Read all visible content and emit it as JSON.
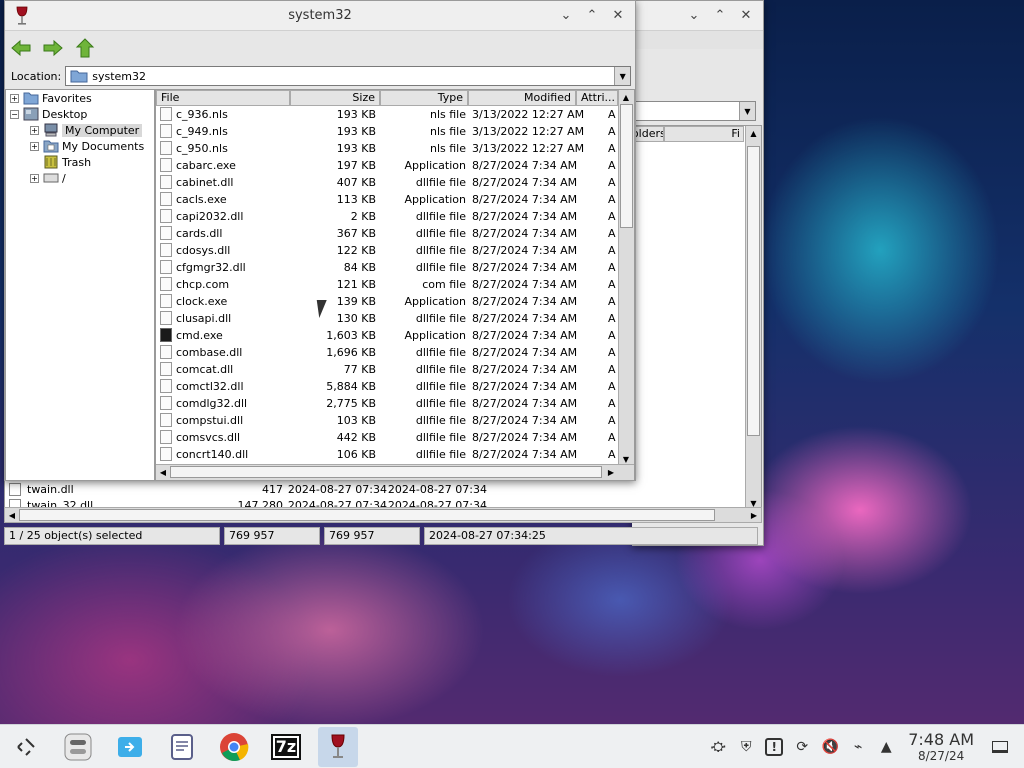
{
  "back_window": {
    "header": {
      "folders": "Folders",
      "fi": "Fi"
    },
    "rows": [
      {
        "name": "twain.dll",
        "size": "417",
        "modified": "2024-08-27 07:34",
        "created": "2024-08-27 07:34"
      },
      {
        "name": "twain_32.dll",
        "size": "147 280",
        "modified": "2024-08-27 07:34",
        "created": "2024-08-27 07:34"
      }
    ],
    "status": [
      "1 / 25 object(s) selected",
      "769 957",
      "769 957",
      "2024-08-27 07:34:25"
    ]
  },
  "front_window": {
    "title": "system32",
    "location_label": "Location:",
    "location_value": "system32",
    "tree": [
      {
        "label": "Favorites"
      },
      {
        "label": "Desktop"
      },
      {
        "label": "My Computer"
      },
      {
        "label": "My Documents"
      },
      {
        "label": "Trash"
      },
      {
        "label": "/"
      }
    ],
    "columns": [
      "File",
      "Size",
      "Type",
      "Modified",
      "Attri..."
    ],
    "files": [
      {
        "name": "c_936.nls",
        "size": "193 KB",
        "type": "nls file",
        "modified": "3/13/2022 12:27 AM",
        "attr": "A"
      },
      {
        "name": "c_949.nls",
        "size": "193 KB",
        "type": "nls file",
        "modified": "3/13/2022 12:27 AM",
        "attr": "A"
      },
      {
        "name": "c_950.nls",
        "size": "193 KB",
        "type": "nls file",
        "modified": "3/13/2022 12:27 AM",
        "attr": "A"
      },
      {
        "name": "cabarc.exe",
        "size": "197 KB",
        "type": "Application",
        "modified": "8/27/2024 7:34 AM",
        "attr": "A"
      },
      {
        "name": "cabinet.dll",
        "size": "407 KB",
        "type": "dllfile file",
        "modified": "8/27/2024 7:34 AM",
        "attr": "A"
      },
      {
        "name": "cacls.exe",
        "size": "113 KB",
        "type": "Application",
        "modified": "8/27/2024 7:34 AM",
        "attr": "A"
      },
      {
        "name": "capi2032.dll",
        "size": "2 KB",
        "type": "dllfile file",
        "modified": "8/27/2024 7:34 AM",
        "attr": "A"
      },
      {
        "name": "cards.dll",
        "size": "367 KB",
        "type": "dllfile file",
        "modified": "8/27/2024 7:34 AM",
        "attr": "A"
      },
      {
        "name": "cdosys.dll",
        "size": "122 KB",
        "type": "dllfile file",
        "modified": "8/27/2024 7:34 AM",
        "attr": "A"
      },
      {
        "name": "cfgmgr32.dll",
        "size": "84 KB",
        "type": "dllfile file",
        "modified": "8/27/2024 7:34 AM",
        "attr": "A"
      },
      {
        "name": "chcp.com",
        "size": "121 KB",
        "type": "com file",
        "modified": "8/27/2024 7:34 AM",
        "attr": "A"
      },
      {
        "name": "clock.exe",
        "size": "139 KB",
        "type": "Application",
        "modified": "8/27/2024 7:34 AM",
        "attr": "A"
      },
      {
        "name": "clusapi.dll",
        "size": "130 KB",
        "type": "dllfile file",
        "modified": "8/27/2024 7:34 AM",
        "attr": "A"
      },
      {
        "name": "cmd.exe",
        "size": "1,603 KB",
        "type": "Application",
        "modified": "8/27/2024 7:34 AM",
        "attr": "A"
      },
      {
        "name": "combase.dll",
        "size": "1,696 KB",
        "type": "dllfile file",
        "modified": "8/27/2024 7:34 AM",
        "attr": "A"
      },
      {
        "name": "comcat.dll",
        "size": "77 KB",
        "type": "dllfile file",
        "modified": "8/27/2024 7:34 AM",
        "attr": "A"
      },
      {
        "name": "comctl32.dll",
        "size": "5,884 KB",
        "type": "dllfile file",
        "modified": "8/27/2024 7:34 AM",
        "attr": "A"
      },
      {
        "name": "comdlg32.dll",
        "size": "2,775 KB",
        "type": "dllfile file",
        "modified": "8/27/2024 7:34 AM",
        "attr": "A"
      },
      {
        "name": "compstui.dll",
        "size": "103 KB",
        "type": "dllfile file",
        "modified": "8/27/2024 7:34 AM",
        "attr": "A"
      },
      {
        "name": "comsvcs.dll",
        "size": "442 KB",
        "type": "dllfile file",
        "modified": "8/27/2024 7:34 AM",
        "attr": "A"
      },
      {
        "name": "concrt140.dll",
        "size": "106 KB",
        "type": "dllfile file",
        "modified": "8/27/2024 7:34 AM",
        "attr": "A"
      }
    ]
  },
  "taskbar": {
    "apps": [
      "app-launcher",
      "overview",
      "file-manager",
      "text-editor",
      "chrome",
      "7zip",
      "wine"
    ],
    "sevenzip_label": "7z",
    "clock_time": "7:48 AM",
    "clock_date": "8/27/24"
  }
}
